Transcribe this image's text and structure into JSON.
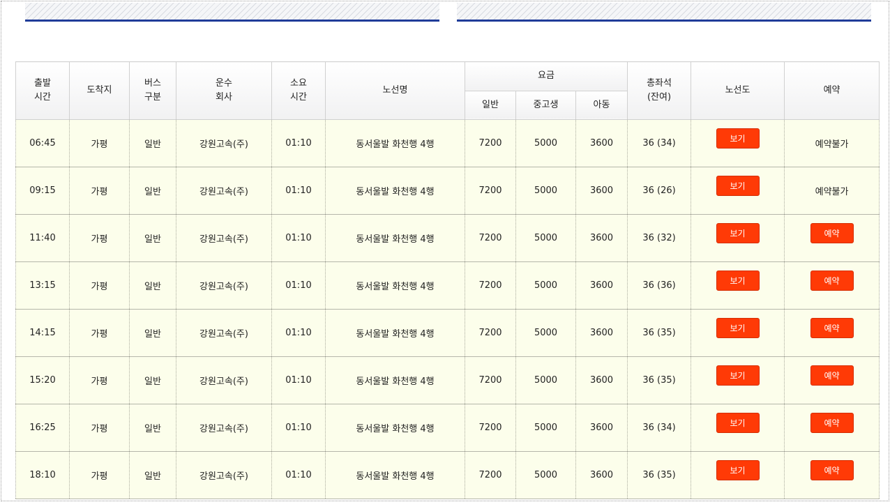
{
  "table": {
    "headers": {
      "departure": "출발\n시간",
      "destination": "도착지",
      "bus_type": "버스\n구분",
      "company": "운수\n회사",
      "duration": "소요\n시간",
      "route": "노선명",
      "fare": "요금",
      "fare_general": "일반",
      "fare_youth": "중고생",
      "fare_child": "아동",
      "seats": "총좌석\n(잔여)",
      "map": "노선도",
      "reserve": "예약"
    },
    "rows": [
      {
        "time": "06:45",
        "dest": "가평",
        "type": "일반",
        "company": "강원고속(주)",
        "duration": "01:10",
        "route": "동서울발 화천행 4행",
        "general": "7200",
        "youth": "5000",
        "child": "3600",
        "seats": "36 (34)",
        "map_label": "보기",
        "reserve_label": "예약불가",
        "reservable": false
      },
      {
        "time": "09:15",
        "dest": "가평",
        "type": "일반",
        "company": "강원고속(주)",
        "duration": "01:10",
        "route": "동서울발 화천행 4행",
        "general": "7200",
        "youth": "5000",
        "child": "3600",
        "seats": "36 (26)",
        "map_label": "보기",
        "reserve_label": "예약불가",
        "reservable": false
      },
      {
        "time": "11:40",
        "dest": "가평",
        "type": "일반",
        "company": "강원고속(주)",
        "duration": "01:10",
        "route": "동서울발 화천행 4행",
        "general": "7200",
        "youth": "5000",
        "child": "3600",
        "seats": "36 (32)",
        "map_label": "보기",
        "reserve_label": "예약",
        "reservable": true
      },
      {
        "time": "13:15",
        "dest": "가평",
        "type": "일반",
        "company": "강원고속(주)",
        "duration": "01:10",
        "route": "동서울발 화천행 4행",
        "general": "7200",
        "youth": "5000",
        "child": "3600",
        "seats": "36 (36)",
        "map_label": "보기",
        "reserve_label": "예약",
        "reservable": true
      },
      {
        "time": "14:15",
        "dest": "가평",
        "type": "일반",
        "company": "강원고속(주)",
        "duration": "01:10",
        "route": "동서울발 화천행 4행",
        "general": "7200",
        "youth": "5000",
        "child": "3600",
        "seats": "36 (35)",
        "map_label": "보기",
        "reserve_label": "예약",
        "reservable": true
      },
      {
        "time": "15:20",
        "dest": "가평",
        "type": "일반",
        "company": "강원고속(주)",
        "duration": "01:10",
        "route": "동서울발 화천행 4행",
        "general": "7200",
        "youth": "5000",
        "child": "3600",
        "seats": "36 (35)",
        "map_label": "보기",
        "reserve_label": "예약",
        "reservable": true
      },
      {
        "time": "16:25",
        "dest": "가평",
        "type": "일반",
        "company": "강원고속(주)",
        "duration": "01:10",
        "route": "동서울발 화천행 4행",
        "general": "7200",
        "youth": "5000",
        "child": "3600",
        "seats": "36 (34)",
        "map_label": "보기",
        "reserve_label": "예약",
        "reservable": true
      },
      {
        "time": "18:10",
        "dest": "가평",
        "type": "일반",
        "company": "강원고속(주)",
        "duration": "01:10",
        "route": "동서울발 화천행 4행",
        "general": "7200",
        "youth": "5000",
        "child": "3600",
        "seats": "36 (35)",
        "map_label": "보기",
        "reserve_label": "예약",
        "reservable": true
      }
    ]
  },
  "colors": {
    "accent_button": "#ff3a06",
    "row_background": "#fcfeeb",
    "tab_underline": "#1f3c99"
  }
}
